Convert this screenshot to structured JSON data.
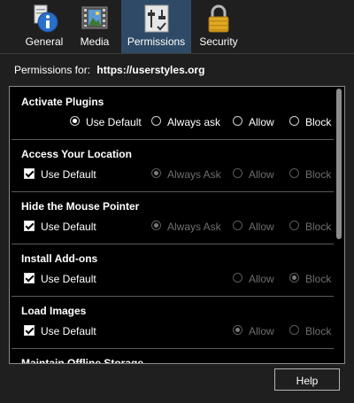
{
  "toolbar": {
    "tabs": [
      {
        "label": "General",
        "icon": "info-icon"
      },
      {
        "label": "Media",
        "icon": "media-icon"
      },
      {
        "label": "Permissions",
        "icon": "permissions-icon",
        "selected": true
      },
      {
        "label": "Security",
        "icon": "lock-icon"
      }
    ]
  },
  "permissions_for": {
    "label": "Permissions for:",
    "site": "https://userstyles.org"
  },
  "sections": [
    {
      "title": "Activate Plugins",
      "options": {
        "use_default": "Use Default",
        "always_ask": "Always ask",
        "allow": "Allow",
        "block": "Block"
      },
      "use_default_checked": true,
      "selected": "use_default"
    },
    {
      "title": "Access Your Location",
      "options": {
        "use_default": "Use Default",
        "always_ask": "Always Ask",
        "allow": "Allow",
        "block": "Block"
      },
      "use_default_checked": true,
      "selected": "always_ask"
    },
    {
      "title": "Hide the Mouse Pointer",
      "options": {
        "use_default": "Use Default",
        "always_ask": "Always Ask",
        "allow": "Allow",
        "block": "Block"
      },
      "use_default_checked": true,
      "selected": "always_ask"
    },
    {
      "title": "Install Add-ons",
      "options": {
        "use_default": "Use Default",
        "allow": "Allow",
        "block": "Block"
      },
      "use_default_checked": true,
      "selected": "block"
    },
    {
      "title": "Load Images",
      "options": {
        "use_default": "Use Default",
        "allow": "Allow",
        "block": "Block"
      },
      "use_default_checked": true,
      "selected": "allow"
    },
    {
      "title": "Maintain Offline Storage"
    }
  ],
  "buttons": {
    "help": "Help"
  },
  "colors": {
    "background": "#1f1f1f",
    "panel": "#000000",
    "selected_tab": "#2f4a66",
    "disabled_text": "#6e6e6e"
  }
}
